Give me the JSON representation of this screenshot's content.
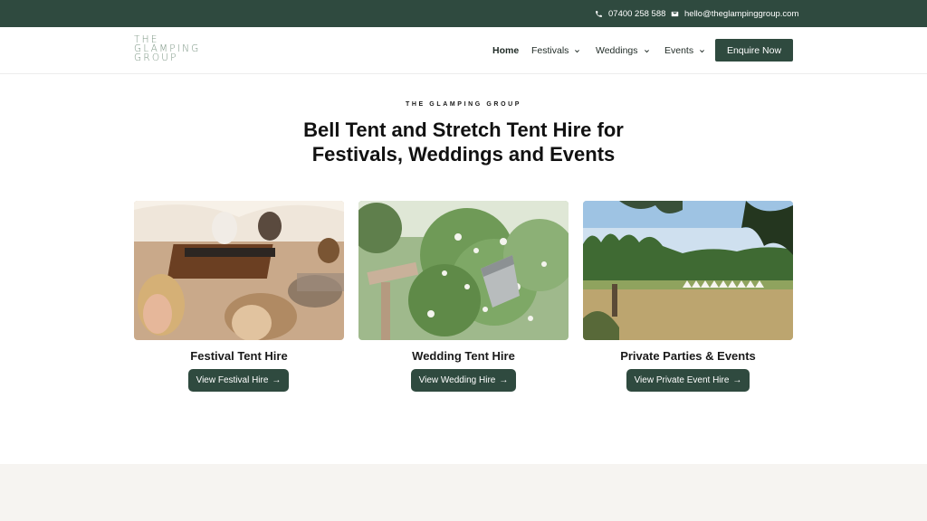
{
  "topbar": {
    "phone": "07400 258 588",
    "email": "hello@theglampinggroup.com",
    "phone_icon": "phone-icon",
    "email_icon": "envelope-icon"
  },
  "header": {
    "logo_lines": [
      "THE",
      "GLAMPING",
      "GROUP"
    ],
    "nav": {
      "home": "Home",
      "festivals": "Festivals",
      "weddings": "Weddings",
      "events": "Events"
    },
    "cta": "Enquire Now"
  },
  "hero": {
    "eyebrow": "THE GLAMPING GROUP",
    "headline_line1": "Bell Tent and Stretch Tent Hire for",
    "headline_line2": "Festivals, Weddings and Events"
  },
  "cards": [
    {
      "title": "Festival Tent Hire",
      "button": "View Festival Hire",
      "arrow": "→"
    },
    {
      "title": "Wedding Tent Hire",
      "button": "View Wedding Hire",
      "arrow": "→"
    },
    {
      "title": "Private Parties & Events",
      "button": "View Private Event Hire",
      "arrow": "→"
    }
  ],
  "colors": {
    "brand": "#2f4a3f",
    "logo": "#7a9482",
    "band": "#f6f4f1"
  }
}
